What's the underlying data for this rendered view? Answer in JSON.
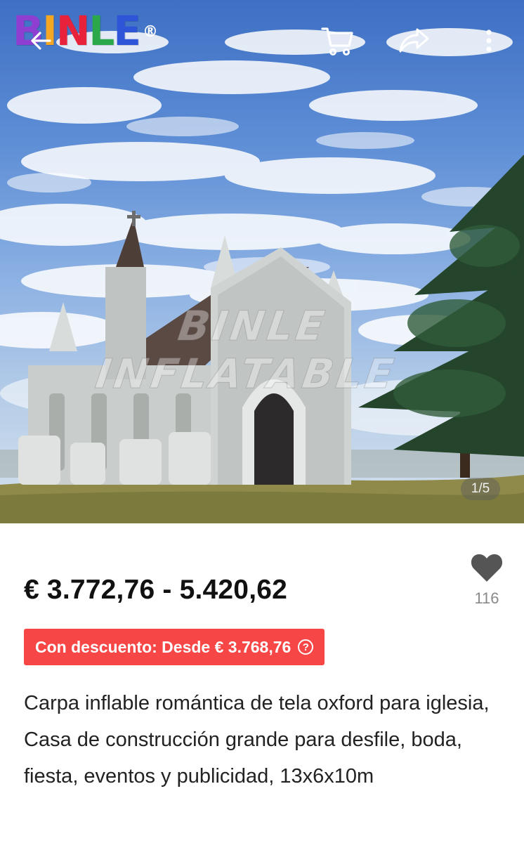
{
  "brand": {
    "logo_letters": [
      "B",
      "I",
      "N",
      "L",
      "E"
    ],
    "logo_colors": [
      "#8e3fd1",
      "#f5a623",
      "#e8223b",
      "#2aa84a",
      "#2e55d8"
    ],
    "registered_mark": "®"
  },
  "toolbar": {
    "back_icon": "back-arrow-icon",
    "cart_icon": "cart-icon",
    "share_icon": "share-icon",
    "more_icon": "more-vertical-icon"
  },
  "gallery": {
    "watermark": "BINLE INFLATABLE",
    "counter": "1/5"
  },
  "product": {
    "price_range": "€ 3.772,76 - 5.420,62",
    "discount_label": "Con descuento: Desde € 3.768,76",
    "discount_help": "?",
    "wishlist_count": "116",
    "title": "Carpa inflable romántica de tela oxford para iglesia, Casa de construcción grande para desfile, boda, fiesta, eventos y publicidad, 13x6x10m"
  },
  "colors": {
    "discount_bg": "#f64646",
    "heart": "#555555",
    "price_text": "#111111"
  }
}
